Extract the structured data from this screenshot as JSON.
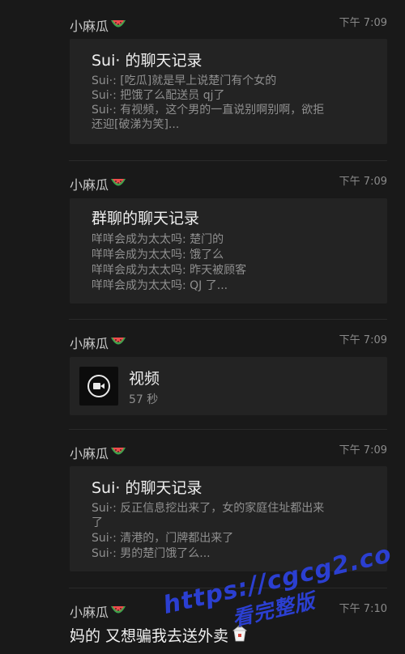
{
  "messages": [
    {
      "sender": "小麻瓜",
      "time": "下午 7:09",
      "card": {
        "title": "Sui· 的聊天记录",
        "lines": [
          "Sui·: [吃瓜]就是早上说楚门有个女的",
          "Sui·: 把饿了么配送员 qj了",
          "Sui·: 有视频，这个男的一直说别啊别啊，欲拒",
          "还迎[破涕为笑]..."
        ]
      }
    },
    {
      "sender": "小麻瓜",
      "time": "下午 7:09",
      "card": {
        "title": "群聊的聊天记录",
        "lines": [
          "咩咩会成为太太吗: 楚门的",
          "咩咩会成为太太吗: 饿了么",
          "咩咩会成为太太吗: 昨天被顾客",
          "咩咩会成为太太吗: QJ 了..."
        ]
      }
    },
    {
      "sender": "小麻瓜",
      "time": "下午 7:09",
      "video": {
        "title": "视频",
        "duration": "57 秒"
      }
    },
    {
      "sender": "小麻瓜",
      "time": "下午 7:09",
      "card": {
        "title": "Sui· 的聊天记录",
        "lines": [
          "Sui·: 反正信息挖出来了，女的家庭住址都出来",
          "了",
          "Sui·: 清港的，门牌都出来了",
          "Sui·: 男的楚门饿了么..."
        ]
      }
    },
    {
      "sender": "小麻瓜",
      "time": "下午 7:10",
      "text": "妈的 又想骗我去送外卖"
    }
  ],
  "icons": {
    "sender_emoji": "watermelon-icon",
    "text_emoji": "takeout-box-icon",
    "video": "video-camera-icon"
  },
  "watermark": {
    "url": "https://cgcg2.co",
    "caption": "看完整版",
    "color": "#2b3fd1"
  }
}
